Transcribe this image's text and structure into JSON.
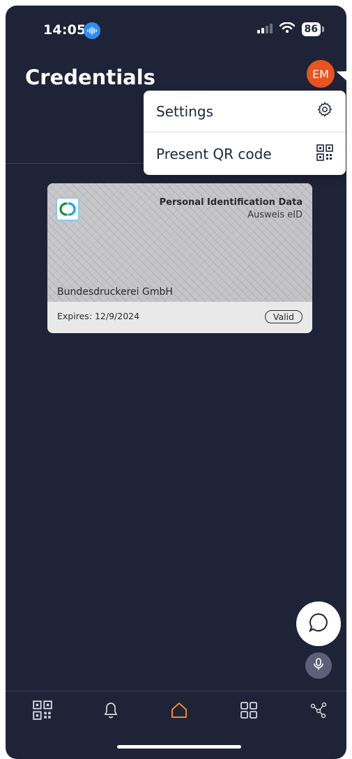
{
  "status_bar": {
    "time": "14:05",
    "battery": "86"
  },
  "header": {
    "title": "Credentials",
    "avatar_initials": "EM"
  },
  "menu": {
    "items": [
      {
        "label": "Settings",
        "icon": "gear-icon"
      },
      {
        "label": "Present QR code",
        "icon": "qr-code-icon"
      }
    ]
  },
  "credential_card": {
    "title": "Personal Identification Data",
    "subtitle": "Ausweis eID",
    "issuer": "Bundesdruckerei GmbH",
    "expiry": "Expires: 12/9/2024",
    "status": "Valid"
  },
  "bottom_nav": {
    "items": [
      "qr-code-icon",
      "bell-icon",
      "home-icon",
      "grid-icon",
      "network-icon"
    ],
    "active": "home-icon"
  },
  "colors": {
    "background": "#1e2338",
    "avatar": "#e9531d",
    "active_nav": "#f08a24",
    "voice_indicator": "#2f8cf5"
  }
}
